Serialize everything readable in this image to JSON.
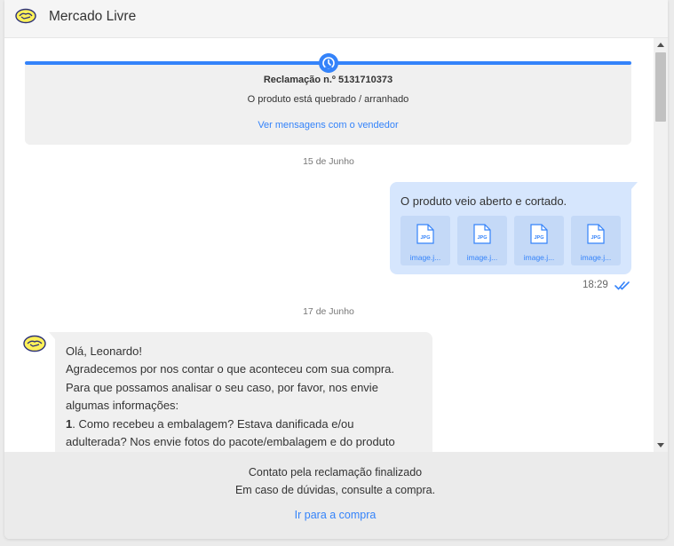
{
  "header": {
    "app_title": "Mercado Livre",
    "logo_icon": "mercado-livre-handshake-logo"
  },
  "claim": {
    "title": "Reclamação n.º 5131710373",
    "subtitle": "O produto está quebrado / arranhado",
    "link": "Ver mensagens com o vendedor",
    "status_icon": "hourglass-icon",
    "accent": "#3483fa"
  },
  "thread": {
    "date1": "15 de Junho",
    "date2": "17 de Junho",
    "outgoing": {
      "text": "O produto veio aberto e cortado.",
      "attachments": [
        {
          "label": "image.j...",
          "type": "JPG"
        },
        {
          "label": "image.j...",
          "type": "JPG"
        },
        {
          "label": "image.j...",
          "type": "JPG"
        },
        {
          "label": "image.j...",
          "type": "JPG"
        }
      ],
      "time": "18:29",
      "status_icon": "double-check-icon"
    },
    "incoming": {
      "lines": [
        "Olá, Leonardo!",
        "Agradecemos por nos contar o que aconteceu com sua compra.",
        "Para que possamos analisar o seu caso, por favor, nos envie",
        "algumas informações:",
        "Como recebeu a embalagem? Estava danificada e/ou",
        "adulterada? Nos envie fotos do pacote/embalagem e do produto"
      ],
      "item_number": "1",
      "item_suffix": ". "
    }
  },
  "footer": {
    "line1": "Contato pela reclamação finalizado",
    "line2": "Em caso de dúvidas, consulte a compra.",
    "link": "Ir para a compra"
  },
  "colors": {
    "bubble_out": "#d6e6fd",
    "bubble_in": "#f0f0f0",
    "brand_yellow": "#fff159"
  }
}
